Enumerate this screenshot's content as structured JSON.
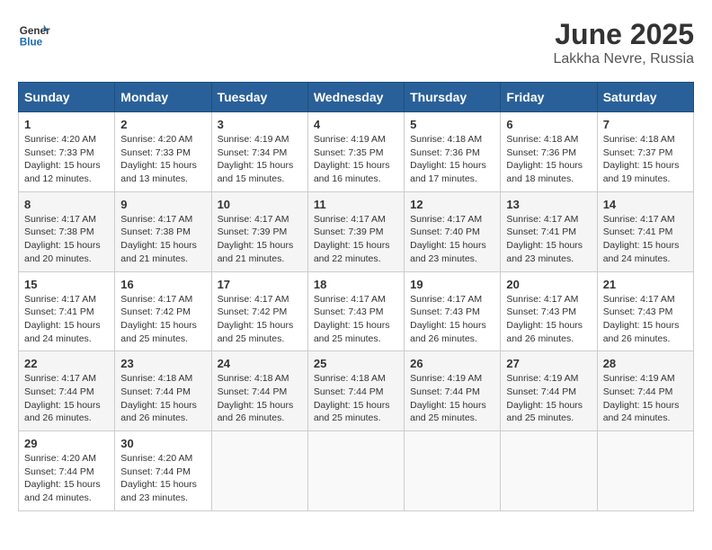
{
  "header": {
    "logo_general": "General",
    "logo_blue": "Blue",
    "title": "June 2025",
    "subtitle": "Lakkha Nevre, Russia"
  },
  "weekdays": [
    "Sunday",
    "Monday",
    "Tuesday",
    "Wednesday",
    "Thursday",
    "Friday",
    "Saturday"
  ],
  "weeks": [
    [
      {
        "day": "1",
        "info": "Sunrise: 4:20 AM\nSunset: 7:33 PM\nDaylight: 15 hours\nand 12 minutes."
      },
      {
        "day": "2",
        "info": "Sunrise: 4:20 AM\nSunset: 7:33 PM\nDaylight: 15 hours\nand 13 minutes."
      },
      {
        "day": "3",
        "info": "Sunrise: 4:19 AM\nSunset: 7:34 PM\nDaylight: 15 hours\nand 15 minutes."
      },
      {
        "day": "4",
        "info": "Sunrise: 4:19 AM\nSunset: 7:35 PM\nDaylight: 15 hours\nand 16 minutes."
      },
      {
        "day": "5",
        "info": "Sunrise: 4:18 AM\nSunset: 7:36 PM\nDaylight: 15 hours\nand 17 minutes."
      },
      {
        "day": "6",
        "info": "Sunrise: 4:18 AM\nSunset: 7:36 PM\nDaylight: 15 hours\nand 18 minutes."
      },
      {
        "day": "7",
        "info": "Sunrise: 4:18 AM\nSunset: 7:37 PM\nDaylight: 15 hours\nand 19 minutes."
      }
    ],
    [
      {
        "day": "8",
        "info": "Sunrise: 4:17 AM\nSunset: 7:38 PM\nDaylight: 15 hours\nand 20 minutes."
      },
      {
        "day": "9",
        "info": "Sunrise: 4:17 AM\nSunset: 7:38 PM\nDaylight: 15 hours\nand 21 minutes."
      },
      {
        "day": "10",
        "info": "Sunrise: 4:17 AM\nSunset: 7:39 PM\nDaylight: 15 hours\nand 21 minutes."
      },
      {
        "day": "11",
        "info": "Sunrise: 4:17 AM\nSunset: 7:39 PM\nDaylight: 15 hours\nand 22 minutes."
      },
      {
        "day": "12",
        "info": "Sunrise: 4:17 AM\nSunset: 7:40 PM\nDaylight: 15 hours\nand 23 minutes."
      },
      {
        "day": "13",
        "info": "Sunrise: 4:17 AM\nSunset: 7:41 PM\nDaylight: 15 hours\nand 23 minutes."
      },
      {
        "day": "14",
        "info": "Sunrise: 4:17 AM\nSunset: 7:41 PM\nDaylight: 15 hours\nand 24 minutes."
      }
    ],
    [
      {
        "day": "15",
        "info": "Sunrise: 4:17 AM\nSunset: 7:41 PM\nDaylight: 15 hours\nand 24 minutes."
      },
      {
        "day": "16",
        "info": "Sunrise: 4:17 AM\nSunset: 7:42 PM\nDaylight: 15 hours\nand 25 minutes."
      },
      {
        "day": "17",
        "info": "Sunrise: 4:17 AM\nSunset: 7:42 PM\nDaylight: 15 hours\nand 25 minutes."
      },
      {
        "day": "18",
        "info": "Sunrise: 4:17 AM\nSunset: 7:43 PM\nDaylight: 15 hours\nand 25 minutes."
      },
      {
        "day": "19",
        "info": "Sunrise: 4:17 AM\nSunset: 7:43 PM\nDaylight: 15 hours\nand 26 minutes."
      },
      {
        "day": "20",
        "info": "Sunrise: 4:17 AM\nSunset: 7:43 PM\nDaylight: 15 hours\nand 26 minutes."
      },
      {
        "day": "21",
        "info": "Sunrise: 4:17 AM\nSunset: 7:43 PM\nDaylight: 15 hours\nand 26 minutes."
      }
    ],
    [
      {
        "day": "22",
        "info": "Sunrise: 4:17 AM\nSunset: 7:44 PM\nDaylight: 15 hours\nand 26 minutes."
      },
      {
        "day": "23",
        "info": "Sunrise: 4:18 AM\nSunset: 7:44 PM\nDaylight: 15 hours\nand 26 minutes."
      },
      {
        "day": "24",
        "info": "Sunrise: 4:18 AM\nSunset: 7:44 PM\nDaylight: 15 hours\nand 26 minutes."
      },
      {
        "day": "25",
        "info": "Sunrise: 4:18 AM\nSunset: 7:44 PM\nDaylight: 15 hours\nand 25 minutes."
      },
      {
        "day": "26",
        "info": "Sunrise: 4:19 AM\nSunset: 7:44 PM\nDaylight: 15 hours\nand 25 minutes."
      },
      {
        "day": "27",
        "info": "Sunrise: 4:19 AM\nSunset: 7:44 PM\nDaylight: 15 hours\nand 25 minutes."
      },
      {
        "day": "28",
        "info": "Sunrise: 4:19 AM\nSunset: 7:44 PM\nDaylight: 15 hours\nand 24 minutes."
      }
    ],
    [
      {
        "day": "29",
        "info": "Sunrise: 4:20 AM\nSunset: 7:44 PM\nDaylight: 15 hours\nand 24 minutes."
      },
      {
        "day": "30",
        "info": "Sunrise: 4:20 AM\nSunset: 7:44 PM\nDaylight: 15 hours\nand 23 minutes."
      },
      null,
      null,
      null,
      null,
      null
    ]
  ]
}
